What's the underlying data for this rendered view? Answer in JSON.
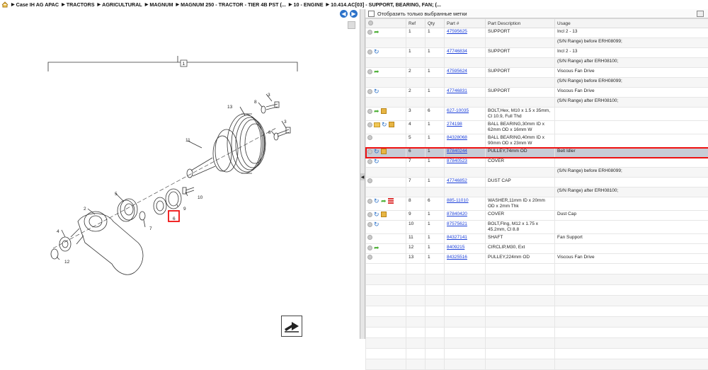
{
  "breadcrumb": {
    "items": [
      "Case IH AG APAC",
      "TRACTORS",
      "AGRICULTURAL",
      "MAGNUM",
      "MAGNUM 250 - TRACTOR - TIER 4B PST (...",
      "10 - ENGINE",
      "10.414.AC[03] - SUPPORT, BEARING, FAN; (..."
    ]
  },
  "filter": {
    "label": "Отобразить только выбранные метки"
  },
  "table": {
    "headers": [
      "",
      "Ref",
      "Qty",
      "Part #",
      "Part Description",
      "Usage"
    ],
    "rows": [
      {
        "icons": [
          "circle",
          "green-arrow"
        ],
        "ref": "1",
        "qty": "1",
        "part": "47595625",
        "desc": "SUPPORT",
        "usage": "Incl 2 - 13"
      },
      {
        "icons": [],
        "ref": "",
        "qty": "",
        "part": "",
        "desc": "",
        "usage": "(S/N Range) before ERH08099;"
      },
      {
        "icons": [
          "circle",
          "blue-arrow"
        ],
        "ref": "1",
        "qty": "1",
        "part": "47746834",
        "desc": "SUPPORT",
        "usage": "Incl 2 - 13"
      },
      {
        "icons": [],
        "ref": "",
        "qty": "",
        "part": "",
        "desc": "",
        "usage": "(S/N Range) after ERH08100;"
      },
      {
        "icons": [
          "circle",
          "green-arrow"
        ],
        "ref": "2",
        "qty": "1",
        "part": "47595624",
        "desc": "SUPPORT",
        "usage": "Viscous Fan Drive"
      },
      {
        "icons": [],
        "ref": "",
        "qty": "",
        "part": "",
        "desc": "",
        "usage": "(S/N Range) before ERH08099;"
      },
      {
        "icons": [
          "circle",
          "blue-arrow"
        ],
        "ref": "2",
        "qty": "1",
        "part": "47746831",
        "desc": "SUPPORT",
        "usage": "Viscous Fan Drive"
      },
      {
        "icons": [],
        "ref": "",
        "qty": "",
        "part": "",
        "desc": "",
        "usage": "(S/N Range) after ERH08100;"
      },
      {
        "icons": [
          "circle",
          "green-arrow",
          "box"
        ],
        "ref": "3",
        "qty": "6",
        "part": "627-10035",
        "desc": "BOLT,Hex, M10 x 1.5 x 35mm, Cl 10.9, Full Thd",
        "usage": ""
      },
      {
        "icons": [
          "circle",
          "folder",
          "blue-arrow",
          "box"
        ],
        "ref": "4",
        "qty": "1",
        "part": "274198",
        "desc": "BALL BEARING,30mm ID x 62mm OD x 16mm W",
        "usage": ""
      },
      {
        "icons": [
          "circle"
        ],
        "ref": "5",
        "qty": "1",
        "part": "84328068",
        "desc": "BALL BEARING,40mm ID x 90mm OD x 23mm W",
        "usage": ""
      },
      {
        "icons": [
          "circle",
          "blue-arrow",
          "box"
        ],
        "ref": "6",
        "qty": "1",
        "part": "87840244",
        "desc": "PULLEY,74mm OD",
        "usage": "Belt Idler",
        "selected": true
      },
      {
        "icons": [
          "circle",
          "blue-arrow"
        ],
        "ref": "7",
        "qty": "1",
        "part": "87840523",
        "desc": "COVER",
        "usage": ""
      },
      {
        "icons": [],
        "ref": "",
        "qty": "",
        "part": "",
        "desc": "",
        "usage": "(S/N Range) before ERH08099;"
      },
      {
        "icons": [
          "circle"
        ],
        "ref": "7",
        "qty": "1",
        "part": "47746852",
        "desc": "DUST CAP",
        "usage": ""
      },
      {
        "icons": [],
        "ref": "",
        "qty": "",
        "part": "",
        "desc": "",
        "usage": "(S/N Range) after ERH08100;"
      },
      {
        "icons": [
          "circle",
          "blue-arrow",
          "green-arrow",
          "lines"
        ],
        "ref": "8",
        "qty": "6",
        "part": "885-11010",
        "desc": "WASHER,11mm ID x 20mm OD x 2mm Thk",
        "usage": ""
      },
      {
        "icons": [
          "circle",
          "blue-arrow",
          "box"
        ],
        "ref": "9",
        "qty": "1",
        "part": "87840420",
        "desc": "COVER",
        "usage": "Dust Cap"
      },
      {
        "icons": [
          "circle",
          "blue-arrow"
        ],
        "ref": "10",
        "qty": "1",
        "part": "87575621",
        "desc": "BOLT,Flng, M12 x 1.75 x 45.2mm, Cl 8.8",
        "usage": ""
      },
      {
        "icons": [
          "circle"
        ],
        "ref": "11",
        "qty": "1",
        "part": "84327141",
        "desc": "SHAFT",
        "usage": "Fan Support"
      },
      {
        "icons": [
          "circle",
          "green-arrow"
        ],
        "ref": "12",
        "qty": "1",
        "part": "8409215",
        "desc": "CIRCLIP,M30, Ext",
        "usage": ""
      },
      {
        "icons": [
          "circle"
        ],
        "ref": "13",
        "qty": "1",
        "part": "84325516",
        "desc": "PULLEY,224mm OD",
        "usage": "Viscous Fan Drive"
      }
    ]
  },
  "diagram": {
    "callouts": [
      "1",
      "2",
      "3",
      "3",
      "4",
      "5",
      "6",
      "7",
      "8",
      "8",
      "9",
      "10",
      "11",
      "12",
      "13"
    ]
  }
}
